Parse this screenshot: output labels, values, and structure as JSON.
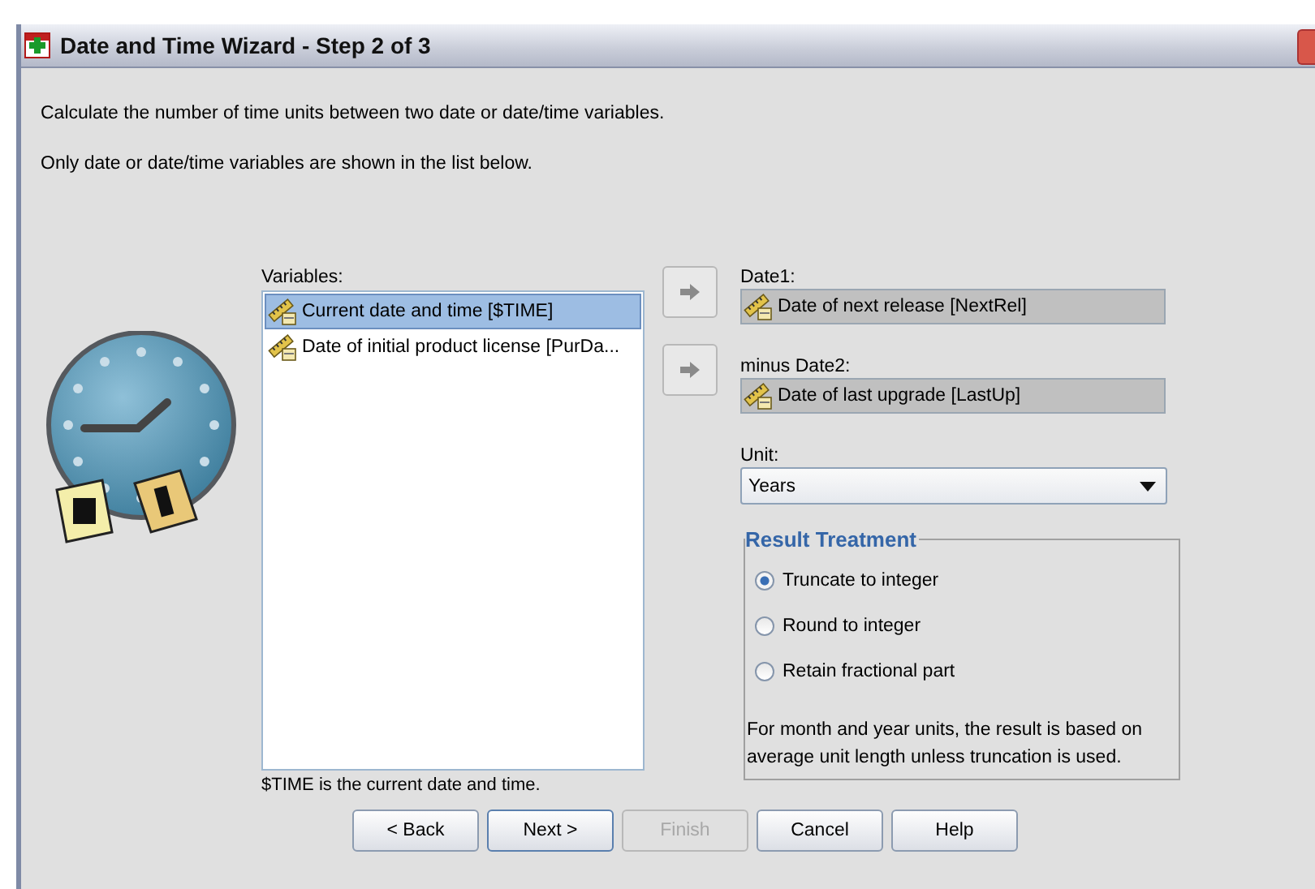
{
  "window": {
    "title": "Date and Time Wizard - Step 2 of 3"
  },
  "intro": [
    "Calculate the number of time units between two date or date/time variables.",
    "Only date or date/time variables are shown in the list below."
  ],
  "variables": {
    "label": "Variables:",
    "items": [
      {
        "label": "Current date and time [$TIME]",
        "selected": true
      },
      {
        "label": "Date of initial product license [PurDa...",
        "selected": false
      }
    ],
    "note": "$TIME is the current date and time."
  },
  "targets": [
    {
      "label": "Date1:",
      "value": "Date of next release [NextRel]"
    },
    {
      "label": "minus Date2:",
      "value": "Date of last upgrade [LastUp]"
    }
  ],
  "unit": {
    "label": "Unit:",
    "value": "Years"
  },
  "result_treatment": {
    "title": "Result Treatment",
    "options": [
      {
        "label": "Truncate to integer",
        "selected": true
      },
      {
        "label": "Round to integer",
        "selected": false
      },
      {
        "label": "Retain fractional part",
        "selected": false
      }
    ],
    "note": "For month and year units, the result is based on average unit length unless truncation is used."
  },
  "buttons": [
    {
      "label": "< Back",
      "disabled": false,
      "default": false
    },
    {
      "label": "Next >",
      "disabled": false,
      "default": true
    },
    {
      "label": "Finish",
      "disabled": true,
      "default": false
    },
    {
      "label": "Cancel",
      "disabled": false,
      "default": false
    },
    {
      "label": "Help",
      "disabled": false,
      "default": false
    }
  ]
}
